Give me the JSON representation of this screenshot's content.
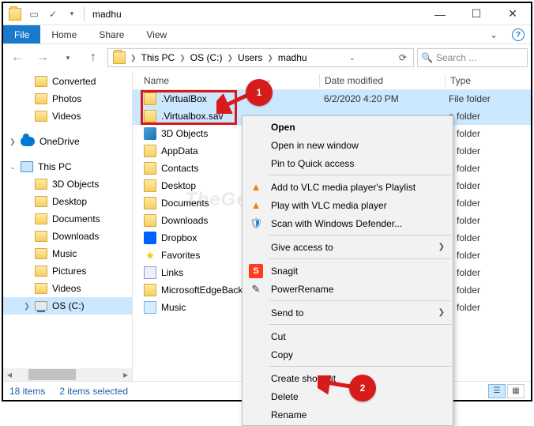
{
  "title": "madhu",
  "ribbon": {
    "file": "File",
    "tabs": [
      "Home",
      "Share",
      "View"
    ]
  },
  "breadcrumbs": [
    "This PC",
    "OS (C:)",
    "Users",
    "madhu"
  ],
  "search_placeholder": "Search ...",
  "nav": {
    "quick": [
      "Converted",
      "Photos",
      "Videos"
    ],
    "onedrive": "OneDrive",
    "thispc": "This PC",
    "thispc_items": [
      "3D Objects",
      "Desktop",
      "Documents",
      "Downloads",
      "Music",
      "Pictures",
      "Videos",
      "OS (C:)"
    ]
  },
  "columns": {
    "name": "Name",
    "date": "Date modified",
    "type": "Type"
  },
  "rows": [
    {
      "name": ".VirtualBox",
      "date": "6/2/2020 4:20 PM",
      "type": "File folder",
      "icon": "ic-folder",
      "sel": true
    },
    {
      "name": ".Virtualbox.sav",
      "date": "",
      "type": "e folder",
      "icon": "ic-folder",
      "sel": true
    },
    {
      "name": "3D Objects",
      "date": "",
      "type": "e folder",
      "icon": "ic-3d"
    },
    {
      "name": "AppData",
      "date": "",
      "type": "e folder",
      "icon": "ic-folder"
    },
    {
      "name": "Contacts",
      "date": "",
      "type": "e folder",
      "icon": "ic-folder"
    },
    {
      "name": "Desktop",
      "date": "",
      "type": "e folder",
      "icon": "ic-folder"
    },
    {
      "name": "Documents",
      "date": "",
      "type": "e folder",
      "icon": "ic-folder"
    },
    {
      "name": "Downloads",
      "date": "",
      "type": "e folder",
      "icon": "ic-folder"
    },
    {
      "name": "Dropbox",
      "date": "",
      "type": "e folder",
      "icon": "ic-drop"
    },
    {
      "name": "Favorites",
      "date": "",
      "type": "e folder",
      "icon": "ic-star"
    },
    {
      "name": "Links",
      "date": "",
      "type": "e folder",
      "icon": "ic-link"
    },
    {
      "name": "MicrosoftEdgeBacku",
      "date": "",
      "type": "e folder",
      "icon": "ic-folder"
    },
    {
      "name": "Music",
      "date": "",
      "type": "e folder",
      "icon": "ic-music"
    }
  ],
  "context_menu": {
    "groups": [
      [
        {
          "label": "Open",
          "bold": true
        },
        {
          "label": "Open in new window"
        },
        {
          "label": "Pin to Quick access"
        }
      ],
      [
        {
          "label": "Add to VLC media player's Playlist",
          "icon": "▲",
          "iconColor": "#ff7b00"
        },
        {
          "label": "Play with VLC media player",
          "icon": "▲",
          "iconColor": "#ff7b00"
        },
        {
          "label": "Scan with Windows Defender...",
          "icon": "🛡",
          "iconColor": "#1979ca"
        }
      ],
      [
        {
          "label": "Give access to",
          "sub": "❯"
        }
      ],
      [
        {
          "label": "Snagit",
          "icon": "S",
          "iconColor": "#ff3b1f"
        },
        {
          "label": "PowerRename",
          "icon": "✎",
          "iconColor": "#333"
        }
      ],
      [
        {
          "label": "Send to",
          "sub": "❯"
        }
      ],
      [
        {
          "label": "Cut"
        },
        {
          "label": "Copy"
        }
      ],
      [
        {
          "label": "Create shortcut"
        },
        {
          "label": "Delete"
        },
        {
          "label": "Rename"
        }
      ]
    ]
  },
  "status": {
    "count": "18 items",
    "selected": "2 items selected"
  },
  "callouts": {
    "one": "1",
    "two": "2"
  }
}
